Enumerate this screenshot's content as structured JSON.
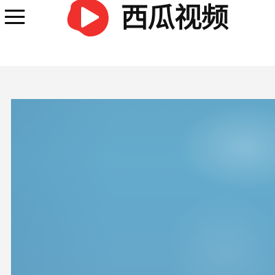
{
  "header": {
    "menu_icon": "hamburger-menu-icon",
    "logo": {
      "icon": "xigua-play-icon",
      "text": "西瓜视频",
      "brand_color": "#f0302c"
    }
  },
  "feed": {
    "video_card": {
      "thumbnail_color": "#65a9cc"
    }
  }
}
